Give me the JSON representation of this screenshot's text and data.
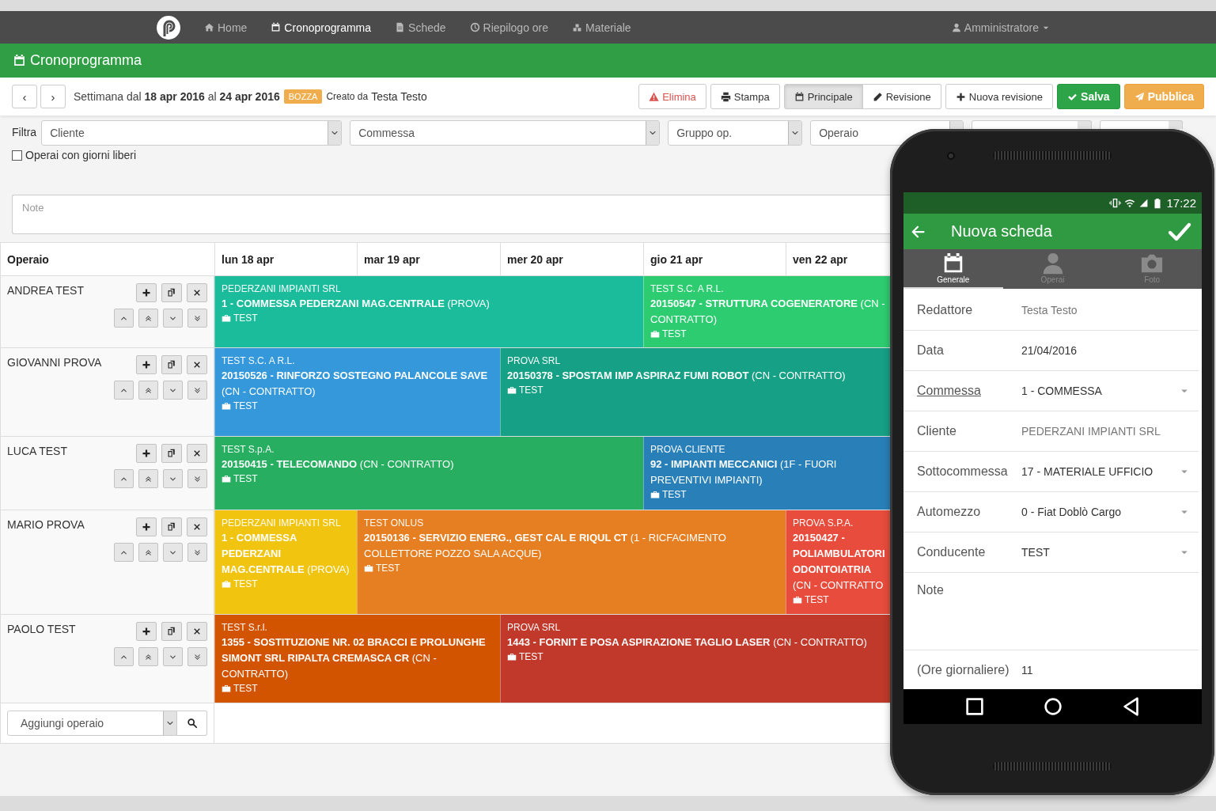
{
  "top_nav": {
    "items": [
      {
        "label": "Home",
        "selected": false
      },
      {
        "label": "Cronoprogramma",
        "selected": true
      },
      {
        "label": "Schede",
        "selected": false
      },
      {
        "label": "Riepilogo ore",
        "selected": false
      },
      {
        "label": "Materiale",
        "selected": false
      }
    ],
    "user": "Amministratore"
  },
  "page_title": "Cronoprogramma",
  "toolbar": {
    "prev": "‹",
    "next": "›",
    "week": "Settimana dal **18 apr 2016** al **24 apr 2016**",
    "status_badge": "BOZZA",
    "created_by_label": "Creato da",
    "created_by": "Testa Testo",
    "actions_left": [
      {
        "label": "Elimina",
        "kind": "danger"
      },
      {
        "label": "Stampa",
        "kind": "default"
      }
    ],
    "view_toggle": [
      {
        "label": "Principale",
        "selected": true
      },
      {
        "label": "Revisione",
        "selected": false
      }
    ],
    "actions_right": [
      {
        "label": "Nuova revisione",
        "kind": "default"
      },
      {
        "label": "Salva",
        "kind": "success"
      },
      {
        "label": "Pubblica",
        "kind": "warning"
      }
    ]
  },
  "filters": {
    "label": "Filtra",
    "selects": [
      {
        "placeholder": "Cliente"
      },
      {
        "placeholder": "Commessa"
      },
      {
        "placeholder": "Gruppo op."
      },
      {
        "placeholder": "Operaio"
      },
      {
        "kind": "stub"
      },
      {
        "kind": "stub"
      }
    ],
    "free_days": {
      "label": "Operai con giorni liberi",
      "checked": false
    }
  },
  "note": {
    "placeholder": "Note"
  },
  "table": {
    "columns": [
      "Operaio",
      "lun 18 apr",
      "mar 19 apr",
      "mer 20 apr",
      "gio 21 apr",
      "ven 22 apr"
    ],
    "rows": [
      {
        "operator": "ANDREA TEST",
        "events": [
          {
            "color": "#1abc9c",
            "client": "PEDERZANI IMPIANTI SRL",
            "title": "**1 - COMMESSA PEDERZANI MAG.CENTRALE** (PROVA)",
            "tag": "TEST"
          },
          {
            "color": "#2ecc71",
            "client": "TEST S.C. A R.L.",
            "title": "**20150547 - STRUTTURA COGENERATORE** (CN - CONTRATTO)",
            "tag": "TEST"
          }
        ]
      },
      {
        "operator": "GIOVANNI PROVA",
        "events": [
          {
            "color": "#3498db",
            "client": "TEST S.C. A R.L.",
            "title": "**20150526 - RINFORZO SOSTEGNO PALANCOLE SAVE** (CN - CONTRATTO)",
            "tag": "TEST"
          },
          {
            "color": "#16a085",
            "client": "PROVA SRL",
            "title": "**20150378 - SPOSTAM IMP ASPIRAZ FUMI ROBOT** (CN - CONTRATTO)",
            "tag": "TEST"
          }
        ]
      },
      {
        "operator": "LUCA TEST",
        "events": [
          {
            "color": "#27ae60",
            "client": "TEST S.p.A.",
            "title": "**20150415 - TELECOMANDO** (CN - CONTRATTO)",
            "tag": "TEST"
          },
          {
            "color": "#2980b9",
            "client": "PROVA CLIENTE",
            "title": "**92 - IMPIANTI MECCANICI** (1F - FUORI PREVENTIVI IMPIANTI)",
            "tag": "TEST"
          }
        ]
      },
      {
        "operator": "MARIO PROVA",
        "events": [
          {
            "color": "#f1c40f",
            "client": "PEDERZANI IMPIANTI SRL",
            "title": "**1 - COMMESSA PEDERZANI MAG.CENTRALE** (PROVA)",
            "tag": "TEST"
          },
          {
            "color": "#e67e22",
            "client": "TEST ONLUS",
            "title": "**20150136 - SERVIZIO ENERG., GEST CAL E RIQUL CT** (1 - RICFACIMENTO COLLETTORE POZZO SALA ACQUE)",
            "tag": "TEST"
          },
          {
            "color": "#e74c3c",
            "client": "PROVA S.P.A.",
            "title": "**20150427 - POLIAMBULATORI ODONTOIATRIA** (CN - CONTRATTO",
            "tag": "TEST"
          }
        ]
      },
      {
        "operator": "PAOLO TEST",
        "events": [
          {
            "color": "#d35400",
            "client": "TEST S.r.l.",
            "title": "**1355 - SOSTITUZIONE NR. 02 BRACCI E PROLUNGHE SIMONT SRL RIPALTA CREMASCA CR** (CN - CONTRATTO)",
            "tag": "TEST"
          },
          {
            "color": "#c0392b",
            "client": "PROVA SRL",
            "title": "**1443 - FORNIT E POSA ASPIRAZIONE TAGLIO LASER** (CN - CONTRATTO)",
            "tag": "TEST"
          }
        ]
      }
    ],
    "add_operator": {
      "placeholder": "Aggiungi operaio"
    }
  },
  "phone": {
    "status_time": "17:22",
    "title": "Nuova scheda",
    "tabs": [
      {
        "label": "Generale",
        "selected": true
      },
      {
        "label": "Operai",
        "selected": false
      },
      {
        "label": "Foto",
        "selected": false
      }
    ],
    "fields": [
      {
        "label": "Redattore",
        "value": "Testa Testo",
        "kind": "static",
        "linked": false
      },
      {
        "label": "Data",
        "value": "21/04/2016",
        "kind": "input",
        "linked": false
      },
      {
        "label": "Commessa",
        "value": "1 - COMMESSA",
        "kind": "select",
        "linked": true
      },
      {
        "label": "Cliente",
        "value": "PEDERZANI IMPIANTI SRL",
        "kind": "static",
        "linked": false
      },
      {
        "label": "Sottocommessa",
        "value": "17 - MATERIALE UFFICIO",
        "kind": "select",
        "linked": false
      },
      {
        "label": "Automezzo",
        "value": "0 - Fiat Doblò Cargo",
        "kind": "select",
        "linked": false
      },
      {
        "label": "Conducente",
        "value": "TEST",
        "kind": "select",
        "linked": false
      },
      {
        "label": "Note",
        "kind": "textarea",
        "linked": false
      },
      {
        "label": "(Ore giornaliere)",
        "value": "11",
        "kind": "input",
        "linked": false
      }
    ]
  }
}
